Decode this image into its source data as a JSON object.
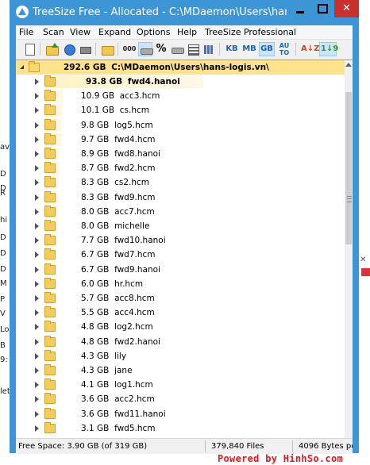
{
  "window": {
    "title": "TreeSize Free - Allocated - C:\\MDaemon\\Users\\hans-",
    "close_glyph": "✕"
  },
  "menu": [
    "File",
    "Scan",
    "View",
    "Expand",
    "Options",
    "Help",
    "TreeSize Professional"
  ],
  "toolbar": {
    "percent_label": "%",
    "kb_label": "KB",
    "mb_label": "MB",
    "gb_label": "GB",
    "auto_label_1": "AU",
    "auto_label_2": "TO",
    "sort_az_label": "A↓Z",
    "sort_num_label": "1↓9",
    "count_label": "000"
  },
  "tree": {
    "root": {
      "size": "292.6 GB",
      "path": "C:\\MDaemon\\Users\\hans-logis.vn\\"
    },
    "items": [
      {
        "size": "93.8 GB",
        "name": "fwd4.hanoi",
        "bold": true,
        "fill": 1.0
      },
      {
        "size": "10.9 GB",
        "name": "acc3.hcm",
        "fill": 0.116
      },
      {
        "size": "10.1 GB",
        "name": "cs.hcm",
        "fill": 0.108
      },
      {
        "size": "9.8 GB",
        "name": "log5.hcm",
        "fill": 0.104
      },
      {
        "size": "9.7 GB",
        "name": "fwd4.hcm",
        "fill": 0.103
      },
      {
        "size": "8.9 GB",
        "name": "fwd8.hanoi",
        "fill": 0.095
      },
      {
        "size": "8.7 GB",
        "name": "fwd2.hcm",
        "fill": 0.093
      },
      {
        "size": "8.3 GB",
        "name": "cs2.hcm",
        "fill": 0.088
      },
      {
        "size": "8.3 GB",
        "name": "fwd9.hcm",
        "fill": 0.088
      },
      {
        "size": "8.0 GB",
        "name": "acc7.hcm",
        "fill": 0.085
      },
      {
        "size": "8.0 GB",
        "name": "michelle",
        "fill": 0.085
      },
      {
        "size": "7.7 GB",
        "name": "fwd10.hanoi",
        "fill": 0.082
      },
      {
        "size": "6.7 GB",
        "name": "fwd7.hcm",
        "fill": 0.071
      },
      {
        "size": "6.7 GB",
        "name": "fwd9.hanoi",
        "fill": 0.071
      },
      {
        "size": "6.0 GB",
        "name": "hr.hcm",
        "fill": 0.064
      },
      {
        "size": "5.7 GB",
        "name": "acc8.hcm",
        "fill": 0.061
      },
      {
        "size": "5.5 GB",
        "name": "acc4.hcm",
        "fill": 0.059
      },
      {
        "size": "4.8 GB",
        "name": "log2.hcm",
        "fill": 0.051
      },
      {
        "size": "4.8 GB",
        "name": "fwd2.hanoi",
        "fill": 0.051
      },
      {
        "size": "4.3 GB",
        "name": "lily",
        "fill": 0.046
      },
      {
        "size": "4.3 GB",
        "name": "jane",
        "fill": 0.046
      },
      {
        "size": "4.1 GB",
        "name": "log1.hcm",
        "fill": 0.044
      },
      {
        "size": "3.6 GB",
        "name": "acc2.hcm",
        "fill": 0.038
      },
      {
        "size": "3.6 GB",
        "name": "fwd11.hanoi",
        "fill": 0.038
      },
      {
        "size": "3.1 GB",
        "name": "fwd5.hcm",
        "fill": 0.033
      }
    ]
  },
  "status": {
    "free_space": "Free Space: 3.90 GB  (of 319 GB)",
    "files": "379,840  Files",
    "cluster": "4096 Bytes per"
  },
  "background": {
    "left_letters": [
      "av",
      "D",
      "D",
      "R",
      "hi",
      "D",
      "D",
      "D",
      "M",
      "P",
      "V",
      "Lo",
      "B",
      "9:",
      "let"
    ],
    "credit": "Powered by HinhSo.com"
  },
  "colors": {
    "titlebar": "#3c95d5",
    "close_button": "#c7302b",
    "root_row": "#ffe28c",
    "folder": "#f4cc5a",
    "credit": "#e8151b"
  }
}
